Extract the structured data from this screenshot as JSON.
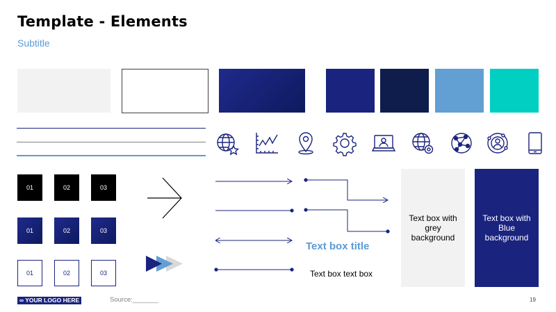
{
  "header": {
    "title": "Template - Elements",
    "subtitle": "Subtitle"
  },
  "colors": {
    "light_grey": "#f2f2f2",
    "white": "#ffffff",
    "gradient_blue": "#1f2a8c",
    "dark_blue": "#1a237e",
    "navy": "#0f1d4c",
    "light_blue": "#629fd2",
    "teal": "#00cfc1",
    "accent_blue": "#5b9bd5"
  },
  "icons": [
    "globe-star-icon",
    "line-chart-icon",
    "location-pin-icon",
    "gear-icon",
    "laptop-user-icon",
    "globe-gear-icon",
    "network-globe-icon",
    "user-orbit-icon",
    "smartphone-icon"
  ],
  "number_boxes": {
    "black": [
      "01",
      "02",
      "03"
    ],
    "blue": [
      "01",
      "02",
      "03"
    ],
    "outline": [
      "01",
      "02",
      "03"
    ]
  },
  "text_box": {
    "title": "Text box title",
    "text": "Text box text box"
  },
  "grey_box": {
    "text": "Text box with grey background"
  },
  "blue_box": {
    "text": "Text box with Blue background"
  },
  "footer": {
    "logo": "∞ YOUR LOGO HERE",
    "source": "Source:_______",
    "page_number": "19"
  }
}
